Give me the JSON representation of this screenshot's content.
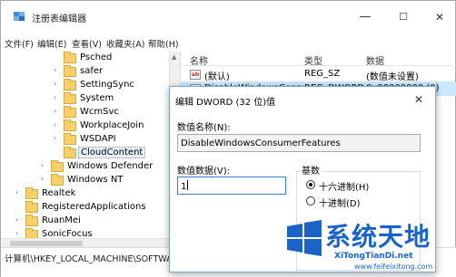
{
  "window": {
    "title": "注册表编辑器",
    "min_glyph": "—",
    "max_glyph": "☐",
    "close_glyph": "✕"
  },
  "menu": [
    "文件(F)",
    "编辑(E)",
    "查看(V)",
    "收藏夹(A)",
    "帮助(H)"
  ],
  "tree": {
    "items": [
      {
        "label": "Psched",
        "arrow": ""
      },
      {
        "label": "safer",
        "arrow": "›"
      },
      {
        "label": "SettingSync",
        "arrow": "›"
      },
      {
        "label": "System",
        "arrow": "›"
      },
      {
        "label": "WcmSvc",
        "arrow": "›"
      },
      {
        "label": "WorkplaceJoin",
        "arrow": "›"
      },
      {
        "label": "WSDAPI",
        "arrow": "›"
      },
      {
        "label": "CloudContent",
        "arrow": ""
      },
      {
        "label": "Windows Defender",
        "arrow": "›"
      },
      {
        "label": "Windows NT",
        "arrow": "›"
      },
      {
        "label": "Realtek",
        "arrow": "›"
      },
      {
        "label": "RegisteredApplications",
        "arrow": ""
      },
      {
        "label": "RuanMei",
        "arrow": "›"
      },
      {
        "label": "SonicFocus",
        "arrow": "›"
      }
    ]
  },
  "list": {
    "headers": {
      "name": "名称",
      "type": "类型",
      "data": "数据"
    },
    "rows": [
      {
        "icon": "ab",
        "name": "(默认)",
        "type": "REG_SZ",
        "data": "(数值未设置)"
      },
      {
        "icon": "011",
        "name": "DisableWindowsConsu...",
        "type": "REG_DWORD",
        "data": "0x00000000 (0)"
      }
    ]
  },
  "status": {
    "path": "计算机\\HKEY_LOCAL_MACHINE\\SOFTWARE\\Policies\\Microsoft\\Windows\\"
  },
  "dialog": {
    "title": "编辑 DWORD (32 位)值",
    "close_glyph": "✕",
    "name_label": "数值名称(N):",
    "name_value": "DisableWindowsConsumerFeatures",
    "data_label": "数值数据(V):",
    "data_value": "1",
    "base_label": "基数",
    "radix_options": [
      {
        "label": "十六进制(H)",
        "checked": true
      },
      {
        "label": "十进制(D)",
        "checked": false
      }
    ]
  },
  "watermark": {
    "title": "系统天地",
    "subtitle": "XiTongTianDi.net",
    "url": "www.feifeixitong.com",
    "color": "#1a64c8"
  }
}
